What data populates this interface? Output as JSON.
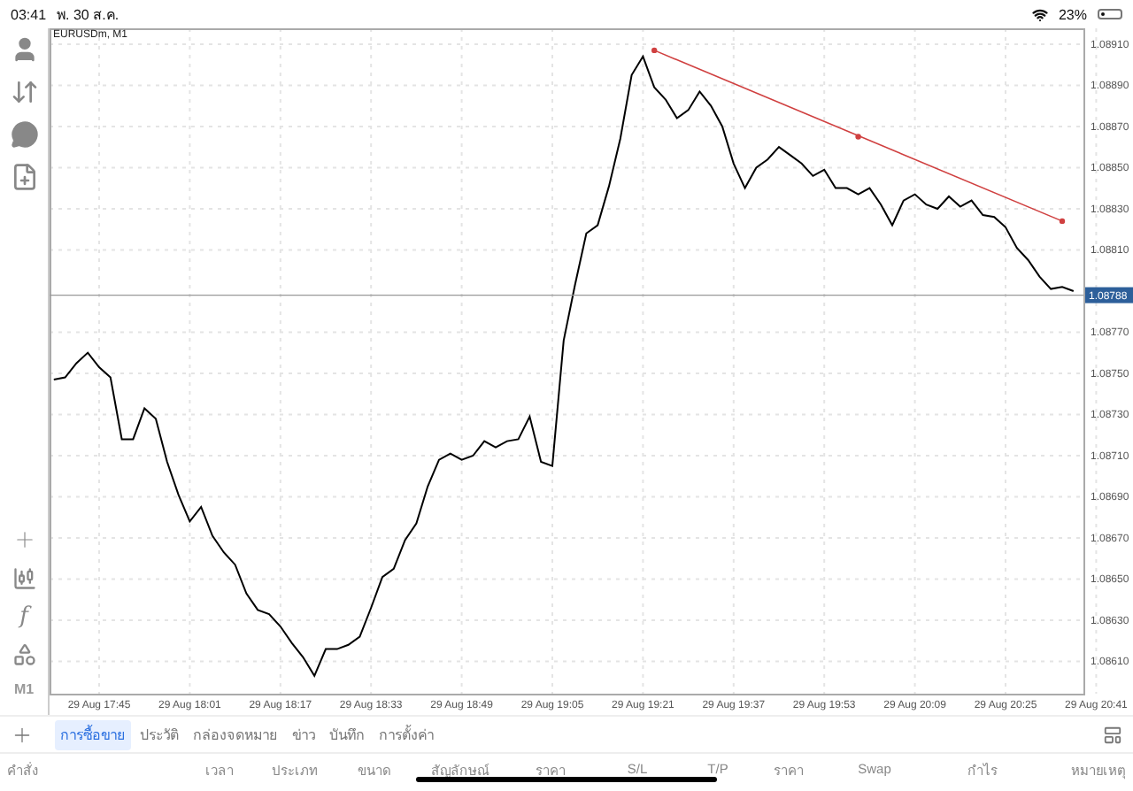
{
  "status_bar": {
    "time": "03:41",
    "date": "พ. 30 ส.ค.",
    "battery": "23%"
  },
  "chart": {
    "symbol": "EURUSDm, M1",
    "chart_data": {
      "type": "line",
      "grid": true,
      "categories": [
        null,
        null,
        null,
        null,
        "29 Aug 17:45",
        null,
        null,
        null,
        null,
        null,
        null,
        null,
        "29 Aug 18:01",
        null,
        null,
        null,
        null,
        null,
        null,
        null,
        "29 Aug 18:17",
        null,
        null,
        null,
        null,
        null,
        null,
        null,
        "29 Aug 18:33",
        null,
        null,
        null,
        null,
        null,
        null,
        null,
        "29 Aug 18:49",
        null,
        null,
        null,
        null,
        null,
        null,
        null,
        "29 Aug 19:05",
        null,
        null,
        null,
        null,
        null,
        null,
        null,
        "29 Aug 19:21",
        null,
        null,
        null,
        null,
        null,
        null,
        null,
        "29 Aug 19:37",
        null,
        null,
        null,
        null,
        null,
        null,
        null,
        "29 Aug 19:53",
        null,
        null,
        null,
        null,
        null,
        null,
        null,
        "29 Aug 20:09",
        null,
        null,
        null,
        null,
        null,
        null,
        null,
        "29 Aug 20:25",
        null,
        null,
        null,
        null,
        null,
        null,
        null,
        "29 Aug 20:41"
      ],
      "series": [
        {
          "color": "#000000",
          "values": [
            1.08747,
            1.08748,
            1.08755,
            1.0876,
            1.08753,
            1.08748,
            1.08718,
            1.08718,
            1.08733,
            1.08728,
            1.08707,
            1.08691,
            1.08678,
            1.08685,
            1.08671,
            1.08663,
            1.08657,
            1.08643,
            1.08635,
            1.08633,
            1.08627,
            1.08619,
            1.08612,
            1.08603,
            1.08616,
            1.08616,
            1.08618,
            1.08622,
            1.08636,
            1.08651,
            1.08655,
            1.08669,
            1.08677,
            1.08695,
            1.08708,
            1.08711,
            1.08708,
            1.0871,
            1.08717,
            1.08714,
            1.08717,
            1.08718,
            1.08729,
            1.08707,
            1.08705,
            1.08766,
            1.08793,
            1.08818,
            1.08822,
            1.08841,
            1.08864,
            1.08895,
            1.08904,
            1.08889,
            1.08883,
            1.08874,
            1.08878,
            1.08887,
            1.0888,
            1.0887,
            1.08852,
            1.0884,
            1.0885,
            1.08854,
            1.0886,
            1.08856,
            1.08852,
            1.08846,
            1.08849,
            1.0884,
            1.0884,
            1.08837,
            1.0884,
            1.08832,
            1.08822,
            1.08834,
            1.08837,
            1.08832,
            1.0883,
            1.08836,
            1.08831,
            1.08834,
            1.08827,
            1.08826,
            1.08821,
            1.08811,
            1.08805,
            1.08797,
            1.08791,
            1.08792,
            1.0879,
            null,
            null
          ]
        },
        {
          "color": "#d04040",
          "values": [
            null,
            null,
            null,
            null,
            null,
            null,
            null,
            null,
            null,
            null,
            null,
            null,
            null,
            null,
            null,
            null,
            null,
            null,
            null,
            null,
            null,
            null,
            null,
            null,
            null,
            null,
            null,
            null,
            null,
            null,
            null,
            null,
            null,
            null,
            null,
            null,
            null,
            null,
            null,
            null,
            null,
            null,
            null,
            null,
            null,
            null,
            null,
            null,
            null,
            null,
            null,
            null,
            null,
            1.08907,
            1.08905,
            1.08902,
            1.089,
            1.08898,
            1.08895,
            1.08893,
            1.08891,
            1.08889,
            1.08886,
            1.08884,
            1.08882,
            1.08879,
            1.08877,
            1.08875,
            1.08872,
            1.0887,
            1.08868,
            1.08865,
            1.08863,
            1.08861,
            1.08859,
            1.08856,
            1.08854,
            1.08852,
            1.08849,
            1.08847,
            1.08845,
            1.08842,
            1.0884,
            1.08838,
            1.08835,
            1.08833,
            1.08831,
            1.08829,
            1.08826,
            1.08824,
            null,
            null,
            null
          ]
        }
      ],
      "ylim": [
        1.085943,
        1.089177
      ],
      "yticks": [
        {
          "value": 1.0891,
          "label": "1.08910"
        },
        {
          "value": 1.0889,
          "label": "1.08890"
        },
        {
          "value": 1.0887,
          "label": "1.08870"
        },
        {
          "value": 1.0885,
          "label": "1.08850"
        },
        {
          "value": 1.0883,
          "label": "1.08830"
        },
        {
          "value": 1.0881,
          "label": "1.08810"
        },
        {
          "value": 1.0877,
          "label": "1.08770"
        },
        {
          "value": 1.0875,
          "label": "1.08750"
        },
        {
          "value": 1.0873,
          "label": "1.08730"
        },
        {
          "value": 1.0871,
          "label": "1.08710"
        },
        {
          "value": 1.0869,
          "label": "1.08690"
        },
        {
          "value": 1.0867,
          "label": "1.08670"
        },
        {
          "value": 1.0865,
          "label": "1.08650"
        },
        {
          "value": 1.0863,
          "label": "1.08630"
        },
        {
          "value": 1.0861,
          "label": "1.08610"
        }
      ],
      "ref_lines": [
        {
          "axis": "y",
          "value": 1.08788,
          "label": "1.08788"
        }
      ]
    }
  },
  "toolbar": {
    "timeframe": "M1",
    "function_glyph": "f"
  },
  "tabs": [
    {
      "label": "การซื้อขาย",
      "selected": true
    },
    {
      "label": "ประวัติ",
      "selected": false
    },
    {
      "label": "กล่องจดหมาย",
      "selected": false
    },
    {
      "label": "ข่าว",
      "selected": false
    },
    {
      "label": "บันทึก",
      "selected": false
    },
    {
      "label": "การตั้งค่า",
      "selected": false
    }
  ],
  "table": {
    "columns": [
      "คำสั่ง",
      "เวลา",
      "ประเภท",
      "ขนาด",
      "สัญลักษณ์",
      "ราคา",
      "S/L",
      "T/P",
      "ราคา",
      "Swap",
      "กำไร",
      "หมายเหตุ"
    ]
  }
}
